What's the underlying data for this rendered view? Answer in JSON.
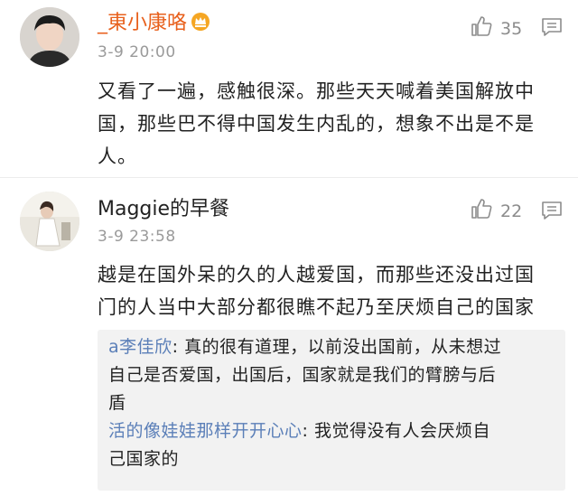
{
  "comments": [
    {
      "author": "_東小康咯",
      "author_color": "#e8601c",
      "badge_icon": "crown-icon",
      "time": "3-9 20:00",
      "likes": "35",
      "text_lines": [
        "又看了一遍，感触很深。那些天天喊着美国解放中",
        "国，那些巴不得中国发生内乱的，想象不出是不是",
        "人。"
      ]
    },
    {
      "author": "Maggie的早餐",
      "author_color": "#222222",
      "time": "3-9 23:58",
      "likes": "22",
      "text_lines": [
        "越是在国外呆的久的人越爱国，而那些还没出过国",
        "门的人当中大部分都很瞧不起乃至厌烦自己的国家"
      ],
      "replies": [
        {
          "name": "a李佳欣",
          "sep": ":",
          "first_line": " 真的很有道理，以前没出国前，从未想过",
          "more_lines": [
            "自己是否爱国，出国后，国家就是我们的臂膀与后",
            "盾"
          ]
        },
        {
          "name": "活的像娃娃那样开开心心",
          "sep": ":",
          "first_line": " 我觉得没有人会厌烦自",
          "more_lines": [
            "己国家的"
          ]
        }
      ]
    }
  ],
  "icons": {
    "like": "thumbs-up-icon",
    "reply": "comment-bubble-icon"
  },
  "colors": {
    "reply_name": "#5b7fb8",
    "reply_bg": "#f2f2f2",
    "meta": "#9a9a9a"
  }
}
